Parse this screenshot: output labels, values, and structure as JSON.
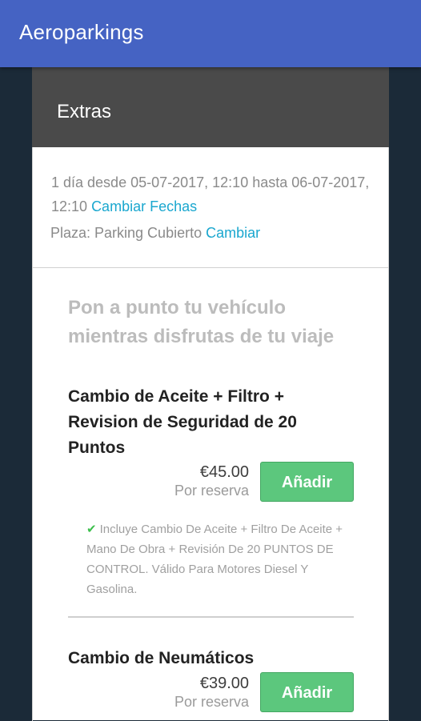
{
  "app": {
    "title": "Aeroparkings"
  },
  "extras": {
    "title": "Extras"
  },
  "booking": {
    "date_text": "1 día desde 05-07-2017, 12:10 hasta 06-07-2017, 12:10",
    "change_dates_label": "Cambiar Fechas",
    "plaza_text": "Plaza: Parking Cubierto",
    "change_plaza_label": "Cambiar"
  },
  "services": {
    "promo_title": "Pon a punto tu vehículo mientras disfrutas de tu viaje",
    "items": [
      {
        "name": "Cambio de Aceite + Filtro + Revision de Seguridad de 20 Puntos",
        "price": "€45.00",
        "per": "Por reserva",
        "button_label": "Añadir",
        "description": "Incluye Cambio De Aceite + Filtro De Aceite + Mano De Obra + Revisión De 20 PUNTOS DE CONTROL. Válido Para Motores Diesel Y Gasolina."
      },
      {
        "name": "Cambio de Neumáticos",
        "price": "€39.00",
        "per": "Por reserva",
        "button_label": "Añadir"
      }
    ]
  },
  "colors": {
    "app_bar": "#4563c3",
    "section_header": "#4a4a4a",
    "link": "#1aa7cf",
    "add_button": "#5cc77d",
    "check": "#3cbf4c",
    "background": "#1b2a38"
  },
  "icons": {
    "included": "check-icon"
  }
}
